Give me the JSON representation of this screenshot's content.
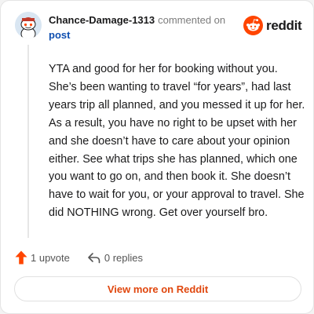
{
  "header": {
    "username": "Chance-Damage-1313",
    "action": "commented on",
    "post_link": "post"
  },
  "brand": {
    "wordmark": "reddit",
    "logo_icon": "reddit-alien-icon",
    "color": "#ff4500"
  },
  "avatar": {
    "icon": "snoo-avatar-icon"
  },
  "comment": {
    "text": "YTA and good for her for booking without you. She’s been wanting to travel “for years”, had last years trip all planned, and you messed it up for her. As a result, you have no right to be upset with her and she doesn’t have to care about your opinion either. See what trips she has planned, which one you want to go on, and then book it. She doesn’t have to wait for you, or your approval to travel. She did NOTHING wrong. Get over yourself bro."
  },
  "actions": {
    "upvote_label": "1 upvote",
    "upvote_icon": "upvote-arrow-icon",
    "upvote_color": "#ff4500",
    "replies_label": "0 replies",
    "reply_icon": "reply-arrow-icon"
  },
  "cta": {
    "label": "View more on Reddit",
    "color": "#e0470e"
  }
}
